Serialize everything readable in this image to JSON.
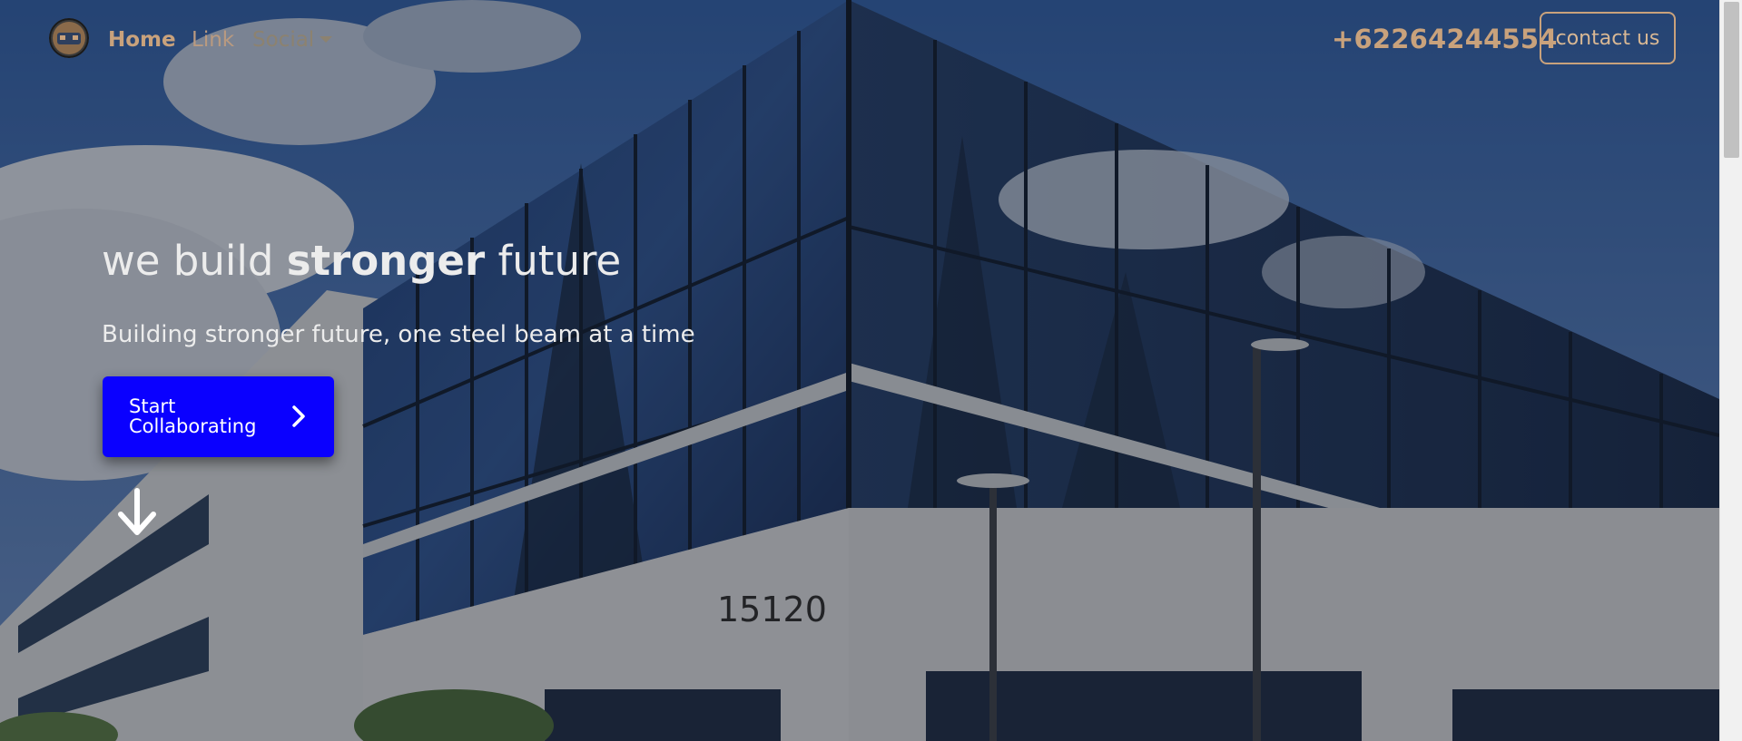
{
  "navbar": {
    "brand_icon": "brand-logo-icon",
    "links": {
      "home": "Home",
      "link": "Link",
      "social": "Social"
    },
    "social_caret_icon": "caret-down-icon",
    "phone": "+62264244554",
    "contact_label": "contact us"
  },
  "hero": {
    "title_prefix": "we build ",
    "title_strong": "stronger",
    "title_suffix": " future",
    "subtitle": "Building stronger future, one steel beam at a time",
    "cta_label": "Start Collaborating",
    "cta_icon": "chevron-right-icon",
    "scroll_icon": "arrow-down-icon",
    "building_number": "15120"
  },
  "colors": {
    "accent": "#c9a27c",
    "cta_background": "#0a00ff",
    "hero_text": "#ececec"
  }
}
